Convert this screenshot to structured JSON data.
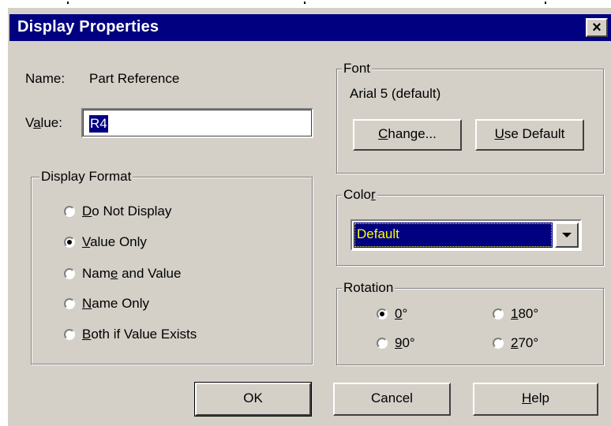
{
  "window": {
    "title": "Display Properties",
    "close_glyph": "×"
  },
  "name_field": {
    "label": "Name:",
    "value": "Part Reference"
  },
  "value_field": {
    "label_pre": "V",
    "label_underlined": "a",
    "label_post": "lue:",
    "value": "R4"
  },
  "display_format": {
    "title": "Display Format",
    "options": [
      {
        "underlined": "D",
        "rest": "o Not Display",
        "pre": "",
        "checked": false
      },
      {
        "underlined": "V",
        "rest": "alue Only",
        "pre": "",
        "checked": true
      },
      {
        "pre": "Nam",
        "underlined": "e",
        "rest": " and Value",
        "checked": false
      },
      {
        "pre": "",
        "underlined": "N",
        "rest": "ame Only",
        "checked": false
      },
      {
        "pre": "",
        "underlined": "B",
        "rest": "oth if Value Exists",
        "checked": false
      }
    ]
  },
  "font_group": {
    "title": "Font",
    "current": "Arial 5 (default)",
    "change_button": {
      "underlined": "C",
      "rest": "hange..."
    },
    "default_button": {
      "underlined": "U",
      "rest": "se Default"
    }
  },
  "color_group": {
    "title_pre": "Colo",
    "title_underlined": "r",
    "selected": "Default"
  },
  "rotation_group": {
    "title": "Rotation",
    "options": [
      {
        "underlined": "0",
        "rest": "°",
        "checked": true
      },
      {
        "underlined": "1",
        "rest": "80°",
        "checked": false
      },
      {
        "underlined": "9",
        "rest": "0°",
        "checked": false
      },
      {
        "underlined": "2",
        "rest": "70°",
        "checked": false
      }
    ]
  },
  "buttons": {
    "ok": "OK",
    "cancel": "Cancel",
    "help_underlined": "H",
    "help_rest": "elp"
  },
  "colors": {
    "titlebar": "#000080",
    "dialog_face": "#d4d0c8",
    "selection_text": "#ffff00"
  }
}
